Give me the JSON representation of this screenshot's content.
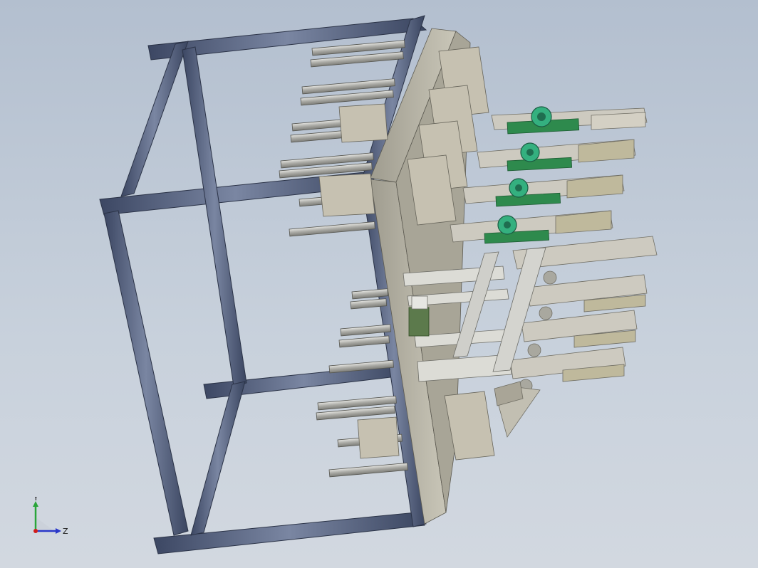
{
  "viewport": {
    "background_top": "#b3bfcf",
    "background_bottom": "#d2d8e0",
    "frame_color": "#4d5a75",
    "plate_color": "#b9b6a8",
    "block_color": "#c6c1b1",
    "rail_color": "#c9c9c4",
    "gear_color": "#2fa67a"
  },
  "triad": {
    "y_label": "Y",
    "z_label": "Z",
    "y_color": "#2aa53a",
    "z_color": "#2a38c9",
    "origin_color": "#d11b1b"
  }
}
